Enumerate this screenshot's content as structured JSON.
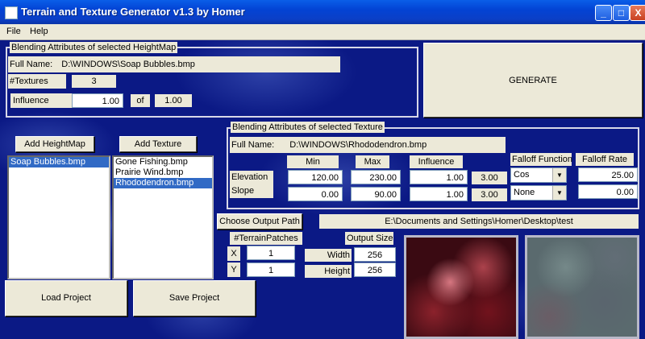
{
  "window": {
    "title": "Terrain and Texture Generator v1.3 by Homer",
    "min_label": "_",
    "max_label": "□",
    "close_label": "X"
  },
  "menu": {
    "file": "File",
    "help": "Help"
  },
  "heightmap_attrs": {
    "caption": "Blending Attributes of selected HeightMap",
    "full_name_label": "Full Name:",
    "full_name_value": "D:\\WINDOWS\\Soap Bubbles.bmp",
    "textures_label": "#Textures",
    "textures_value": "3",
    "influence_label": "Influence",
    "influence_value": "1.00",
    "of_label": "of",
    "influence_total": "1.00"
  },
  "generate_label": "GENERATE",
  "add_heightmap_label": "Add HeightMap",
  "add_texture_label": "Add Texture",
  "heightmaps": [
    {
      "name": "Soap Bubbles.bmp",
      "selected": true
    }
  ],
  "textures": [
    {
      "name": "Gone Fishing.bmp",
      "selected": false
    },
    {
      "name": "Prairie Wind.bmp",
      "selected": false
    },
    {
      "name": "Rhododendron.bmp",
      "selected": true
    }
  ],
  "texture_attrs": {
    "caption": "Blending Attributes of selected Texture",
    "full_name_label": "Full Name:",
    "full_name_value": "D:\\WINDOWS\\Rhododendron.bmp",
    "min_header": "Min",
    "max_header": "Max",
    "influence_header": "Influence",
    "falloff_function_header": "Falloff Function",
    "falloff_rate_header": "Falloff Rate",
    "elevation": {
      "label": "Elevation",
      "min": "120.00",
      "max": "230.00",
      "influence": "1.00",
      "influence_total": "3.00",
      "falloff": "Cos",
      "rate": "25.00"
    },
    "slope": {
      "label": "Slope",
      "min": "0.00",
      "max": "90.00",
      "influence": "1.00",
      "influence_total": "3.00",
      "falloff": "None",
      "rate": "0.00"
    }
  },
  "output": {
    "choose_path_label": "Choose Output Path",
    "path_value": "E:\\Documents and Settings\\Homer\\Desktop\\test",
    "terrain_patches_label": "#TerrainPatches",
    "x_label": "X",
    "x_value": "1",
    "y_label": "Y",
    "y_value": "1",
    "output_size_label": "Output Size",
    "width_label": "Width",
    "width_value": "256",
    "height_label": "Height",
    "height_value": "256"
  },
  "load_project_label": "Load Project",
  "save_project_label": "Save Project"
}
